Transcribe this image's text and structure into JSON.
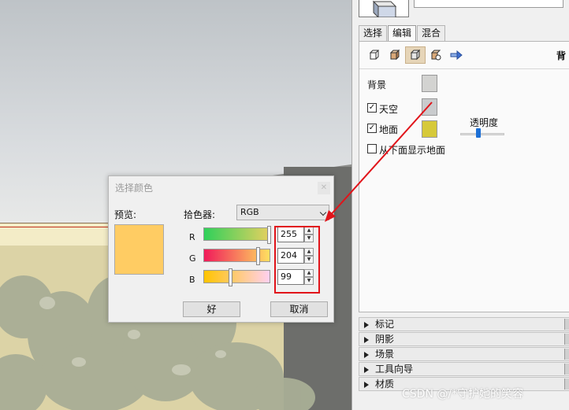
{
  "panel": {
    "tabs": [
      {
        "label": "选择"
      },
      {
        "label": "编辑"
      },
      {
        "label": "混合"
      }
    ],
    "section_title": "背",
    "background_label": "背景",
    "sky_label": "天空",
    "ground_label": "地面",
    "transparency_label": "透明度",
    "show_ground_below_label": "从下面显示地面",
    "colors": {
      "background": "#d3d3d1",
      "sky": "#c9cbcd",
      "ground": "#d6c93a"
    },
    "sky_checked": true,
    "ground_checked": true,
    "show_ground_below_checked": false,
    "collapsed_sections": [
      {
        "label": "标记"
      },
      {
        "label": "阴影"
      },
      {
        "label": "场景"
      },
      {
        "label": "工具向导"
      },
      {
        "label": "材质"
      }
    ]
  },
  "dialog": {
    "title": "选择颜色",
    "preview_label": "预览:",
    "picker_label": "拾色器:",
    "mode": "RGB",
    "preview_color": "#ffcc63",
    "channels": [
      {
        "label": "R",
        "value": "255"
      },
      {
        "label": "G",
        "value": "204"
      },
      {
        "label": "B",
        "value": "99"
      }
    ],
    "ok_label": "好",
    "cancel_label": "取消"
  },
  "watermark": "CSDN @/*守护她的笑容"
}
